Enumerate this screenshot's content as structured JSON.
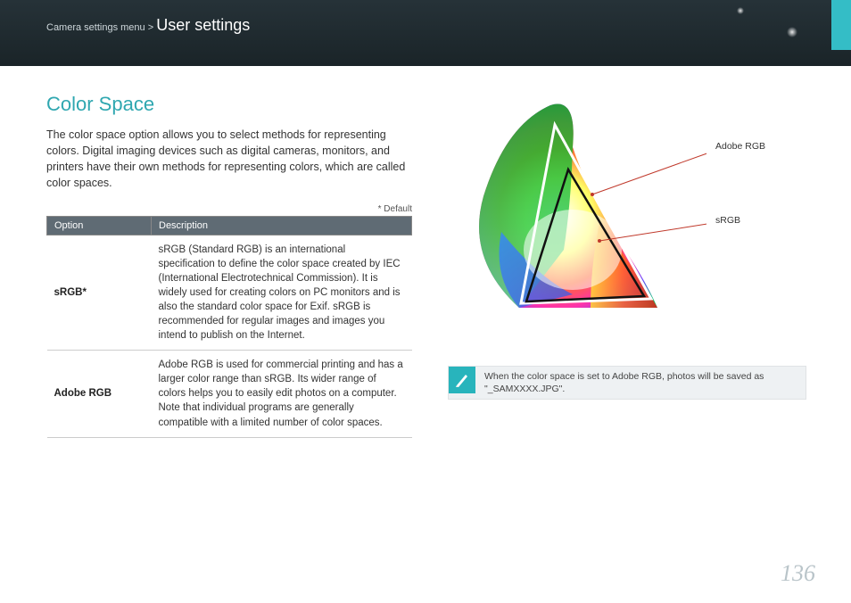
{
  "breadcrumb": {
    "prefix": "Camera settings menu >",
    "title": "User settings"
  },
  "section_title": "Color Space",
  "intro": "The color space option allows you to select methods for representing colors. Digital imaging devices such as digital cameras, monitors, and printers have their own methods for representing colors, which are called color spaces.",
  "default_note": "* Default",
  "table": {
    "headers": {
      "option": "Option",
      "description": "Description"
    },
    "rows": [
      {
        "option": "sRGB*",
        "description": "sRGB (Standard RGB) is an international specification to define the color space created by IEC (International Electrotechnical Commission). It is widely used for creating colors on PC monitors and is also the standard color space for Exif. sRGB is recommended for regular images and images you intend to publish on the Internet."
      },
      {
        "option": "Adobe RGB",
        "description": "Adobe RGB is used for commercial printing and has a larger color range than sRGB. Its wider range of colors helps you to easily edit photos on a computer. Note that individual programs are generally compatible with a limited number of color spaces."
      }
    ]
  },
  "diagram_labels": {
    "adobe": "Adobe RGB",
    "srgb": "sRGB"
  },
  "note": "When the color space is set to Adobe RGB, photos will be saved as \"_SAMXXXX.JPG\".",
  "page_number": "136"
}
